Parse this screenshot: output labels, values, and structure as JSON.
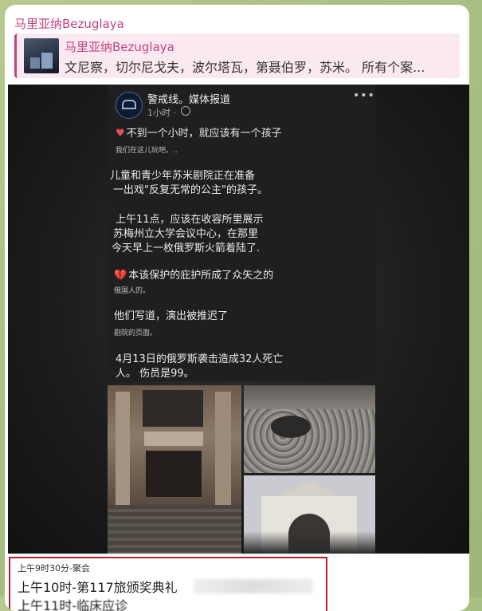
{
  "message": {
    "sender": "马里亚纳Bezuglaya",
    "reply": {
      "name": "马里亚纳Bezuglaya",
      "text": "文尼察，切尔尼戈夫，波尔塔瓦，第聂伯罗，苏米。 所有个案..."
    }
  },
  "facebook_post": {
    "page_name": "警戒线。媒体报道",
    "time": "1小时 ·",
    "more_icon": "more-dots-icon",
    "lines": [
      "不到一个小时，就应该有一个孩子",
      "儿童和青少年苏米剧院正在准备",
      "一出戏\"反复无常的公主\"的孩子。",
      "上午11点，应该在收容所里展示",
      "苏梅州立大学会议中心，在那里",
      "今天早上一枚俄罗斯火箭着陆了.",
      "本该保护的庇护所成了众矢之的",
      "他们写道，演出被推迟了",
      "4月13日的俄罗斯袭击造成32人死亡",
      "人。 伤员是99。"
    ],
    "small_lines": [
      "我们在这儿玩吧。..",
      "俄国人的。",
      "剧院的页面。"
    ],
    "heart_icon": "white-heart-icon",
    "broken_heart_icon": "broken-heart-icon"
  },
  "schedule": {
    "line1": "上午9时30分-聚会",
    "line2": "上午10时-第117旅颁奖典礼",
    "line3": "上午11时-临床应诊"
  }
}
